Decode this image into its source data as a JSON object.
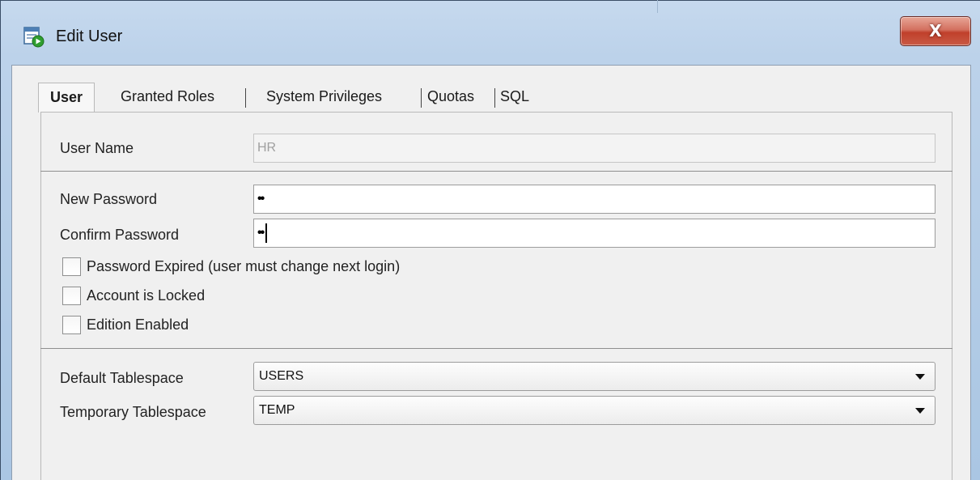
{
  "window": {
    "title": "Edit User",
    "icon": "edit-user-icon",
    "close_label": "X"
  },
  "tabs": [
    {
      "label": "User",
      "active": true
    },
    {
      "label": "Granted Roles",
      "active": false
    },
    {
      "label": "System Privileges",
      "active": false
    },
    {
      "label": "Quotas",
      "active": false
    },
    {
      "label": "SQL",
      "active": false
    }
  ],
  "form": {
    "user_name": {
      "label": "User Name",
      "value": "HR",
      "disabled": true
    },
    "new_password": {
      "label": "New Password",
      "value": "••"
    },
    "confirm_password": {
      "label": "Confirm Password",
      "value": "••"
    },
    "checkboxes": [
      {
        "label": "Password Expired (user must change next login)",
        "checked": false
      },
      {
        "label": "Account is Locked",
        "checked": false
      },
      {
        "label": "Edition Enabled",
        "checked": false
      }
    ],
    "default_tablespace": {
      "label": "Default Tablespace",
      "value": "USERS"
    },
    "temporary_tablespace": {
      "label": "Temporary Tablespace",
      "value": "TEMP"
    }
  },
  "colors": {
    "titlebar": "#bcd2ea",
    "close_button": "#c7432f",
    "panel_background": "#f0f0f0"
  }
}
